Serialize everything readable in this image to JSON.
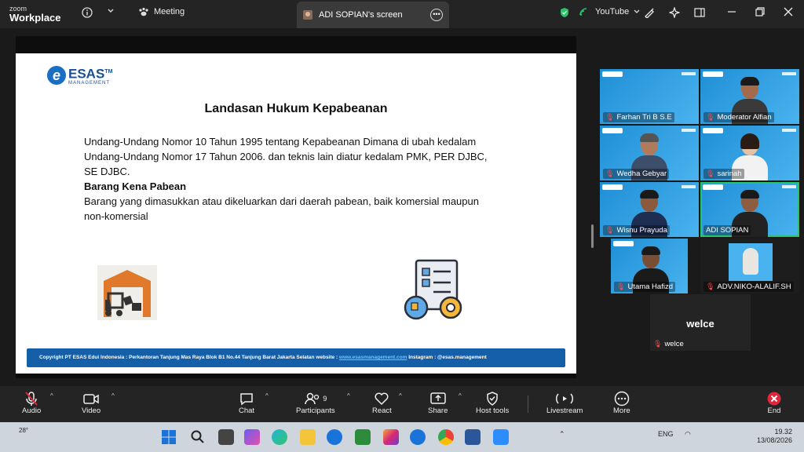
{
  "titlebar": {
    "logo_top": "zoom",
    "logo_bottom": "Workplace",
    "meeting_label": "Meeting",
    "share_tab": "ADI SOPIAN's screen",
    "youtube_label": "YouTube"
  },
  "slide": {
    "brand": "ESAS",
    "brand_tm": "TM",
    "brand_sub": "MANAGEMENT",
    "title": "Landasan Hukum Kepabeanan",
    "para1": "Undang-Undang Nomor 10 Tahun 1995 tentang Kepabeanan Dimana di ubah kedalam Undang-Undang Nomor 17 Tahun 2006. dan teknis lain diatur kedalam PMK, PER DJBC, SE DJBC.",
    "heading2": "Barang Kena Pabean",
    "para2": "Barang yang dimasukkan atau dikeluarkan dari daerah pabean, baik komersial maupun non-komersial",
    "footer_left": "Copyright PT ESAS Edu",
    "footer_mid": "i Indonesia : Perkantoran Tanjung Mas Raya Blok B1 No.44 Tanjung Barat Jakarta Selatan website : ",
    "footer_url": "www.esasmanagement.com",
    "footer_ig": " Instagram : @esas.management"
  },
  "participants": [
    {
      "name": "Farhan Tri B S.E"
    },
    {
      "name": "Moderator Alfian"
    },
    {
      "name": "Wedha Gebyar"
    },
    {
      "name": "sarinah"
    },
    {
      "name": "Wisnu Prayuda"
    },
    {
      "name": "ADI SOPIAN"
    },
    {
      "name": "Utama Hafizd"
    },
    {
      "name": "ADV.NIKO-ALALIF.SH"
    }
  ],
  "welce": {
    "display": "welce",
    "name": "welce"
  },
  "toolbar": {
    "audio": "Audio",
    "video": "Video",
    "chat": "Chat",
    "participants": "Participants",
    "participants_count": "9",
    "react": "React",
    "share": "Share",
    "host_tools": "Host tools",
    "livestream": "Livestream",
    "more": "More",
    "end": "End"
  },
  "taskbar": {
    "weather": "28°",
    "lang": "ENG",
    "time": "19.32",
    "date": "13/08/2026"
  },
  "colors": {
    "accent_blue": "#155fa8",
    "active_tile": "#27c46a",
    "end_red": "#e0263a"
  }
}
